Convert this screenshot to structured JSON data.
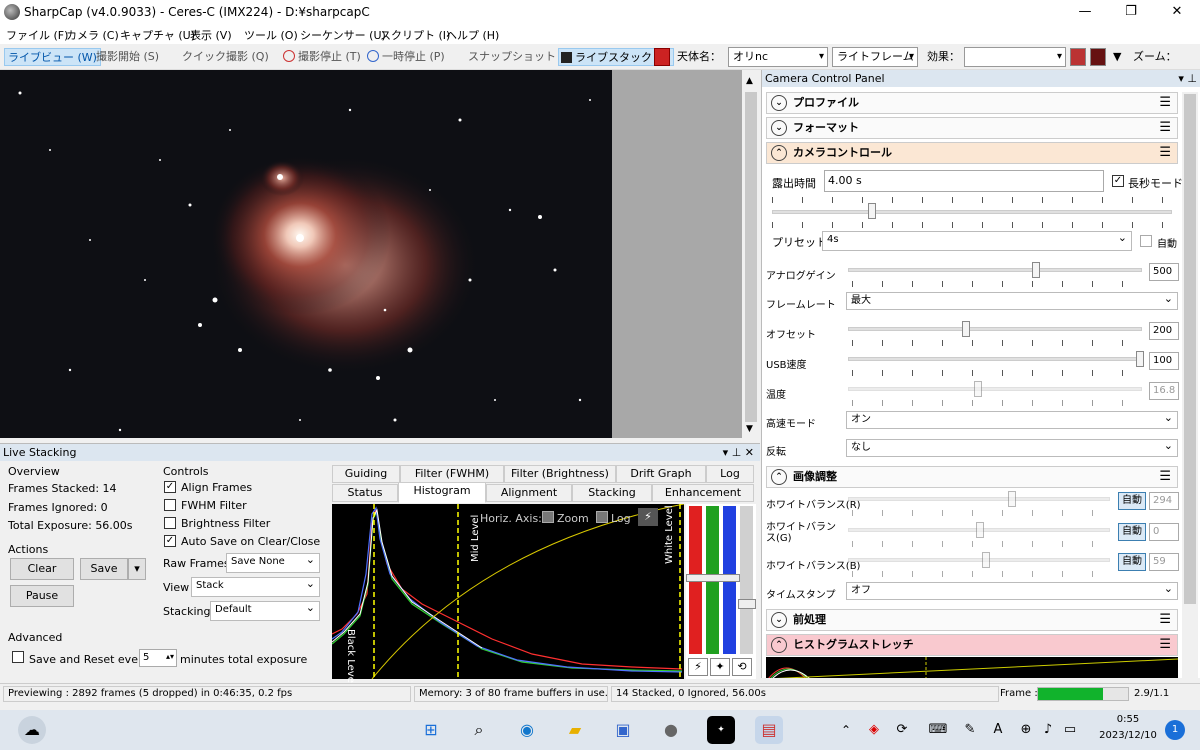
{
  "window": {
    "title": "SharpCap (v4.0.9033) - Ceres-C (IMX224) - D:¥sharpcapC",
    "minimize": "—",
    "maximize": "❐",
    "close": "✕"
  },
  "menu": [
    "ファイル (F)",
    "カメラ (C)",
    "キャプチャ (U)",
    "表示 (V)",
    "ツール (O)",
    "シーケンサー (U)",
    "スクリプト (I)",
    "ヘルプ (H)"
  ],
  "toolbar": {
    "live_preview": "ライブビュー (W)",
    "start_capture": "撮影開始 (S)",
    "quick_capture": "クイック撮影 (Q)",
    "stop_capture": "撮影停止 (T)",
    "pause": "一時停止 (P)",
    "snapshot": "スナップショット (A)",
    "live_stack": "ライブスタック (L)",
    "target_label": "天体名：",
    "target_value": "オリnc",
    "frame_type": "ライトフレーム",
    "effect_label": "効果：",
    "effect_value": "",
    "zoom_label": "ズーム："
  },
  "camera_panel": {
    "title": "Camera Control Panel",
    "profile": "プロファイル",
    "format": "フォーマット",
    "camera_control": "カメラコントロール",
    "exposure_label": "露出時間",
    "exposure_value": "4.00 s",
    "long_mode": "長秒モード",
    "preset_label": "プリセット",
    "preset_value": "4s",
    "auto": "自動",
    "analog_gain_label": "アナログゲイン",
    "analog_gain_value": "500",
    "framerate_label": "フレームレート",
    "framerate_value": "最大",
    "offset_label": "オフセット",
    "offset_value": "200",
    "usb_label": "USB速度",
    "usb_value": "100",
    "temp_label": "温度",
    "temp_value": "16.8",
    "highspeed_label": "高速モード",
    "highspeed_value": "オン",
    "flip_label": "反転",
    "flip_value": "なし",
    "image_adjust": "画像調整",
    "wb_r_label": "ホワイトバランス(R)",
    "wb_r_value": "294",
    "wb_g_label": "ホワイトバランス(G)",
    "wb_g_value": "0",
    "wb_b_label": "ホワイトバランス(B)",
    "wb_b_value": "59",
    "timestamp_label": "タイムスタンプ",
    "timestamp_value": "オフ",
    "preprocess": "前処理",
    "histstretch": "ヒストグラムストレッチ"
  },
  "live_stacking": {
    "title": "Live Stacking",
    "overview": "Overview",
    "frames_stacked": "Frames Stacked: 14",
    "frames_ignored": "Frames Ignored: 0",
    "total_exposure": "Total Exposure:  56.00s",
    "actions": "Actions",
    "clear": "Clear",
    "save": "Save",
    "pause": "Pause",
    "advanced": "Advanced",
    "save_reset": "Save and Reset every",
    "minutes_value": "5",
    "minutes_label": "minutes total exposure",
    "controls": "Controls",
    "align_frames": "Align Frames",
    "fwhm_filter": "FWHM Filter",
    "brightness_filter": "Brightness Filter",
    "auto_save": "Auto Save on Clear/Close",
    "raw_frames_label": "Raw Frames",
    "raw_frames_value": "Save None",
    "view_label": "View",
    "view_value": "Stack",
    "stacking_label": "Stacking",
    "stacking_value": "Default",
    "tabs_top": [
      "Guiding",
      "Filter (FWHM)",
      "Filter (Brightness)",
      "Drift Graph",
      "Log"
    ],
    "tabs_bottom": [
      "Status",
      "Histogram",
      "Alignment",
      "Stacking",
      "Enhancement"
    ],
    "hist_axis": "Horiz. Axis:",
    "hist_zoom": "Zoom",
    "hist_log": "Log",
    "black_level": "Black Level",
    "mid_level": "Mid Level",
    "white_level": "White Level"
  },
  "status": {
    "previewing": "Previewing : 2892 frames (5 dropped) in 0:46:35, 0.2 fps",
    "memory": "Memory: 3 of 80 frame buffers in use.",
    "stacked": "14 Stacked, 0 Ignored, 56.00s",
    "frame_label": "Frame :",
    "frame_progress": 0.72,
    "frame_ratio": "2.9/1.1"
  },
  "taskbar": {
    "time": "0:55",
    "date": "2023/12/10",
    "notif": "1"
  },
  "colors": {
    "accent": "#cce4f7",
    "hist_bg": "#000000",
    "frame_bar": "#11b32c"
  }
}
